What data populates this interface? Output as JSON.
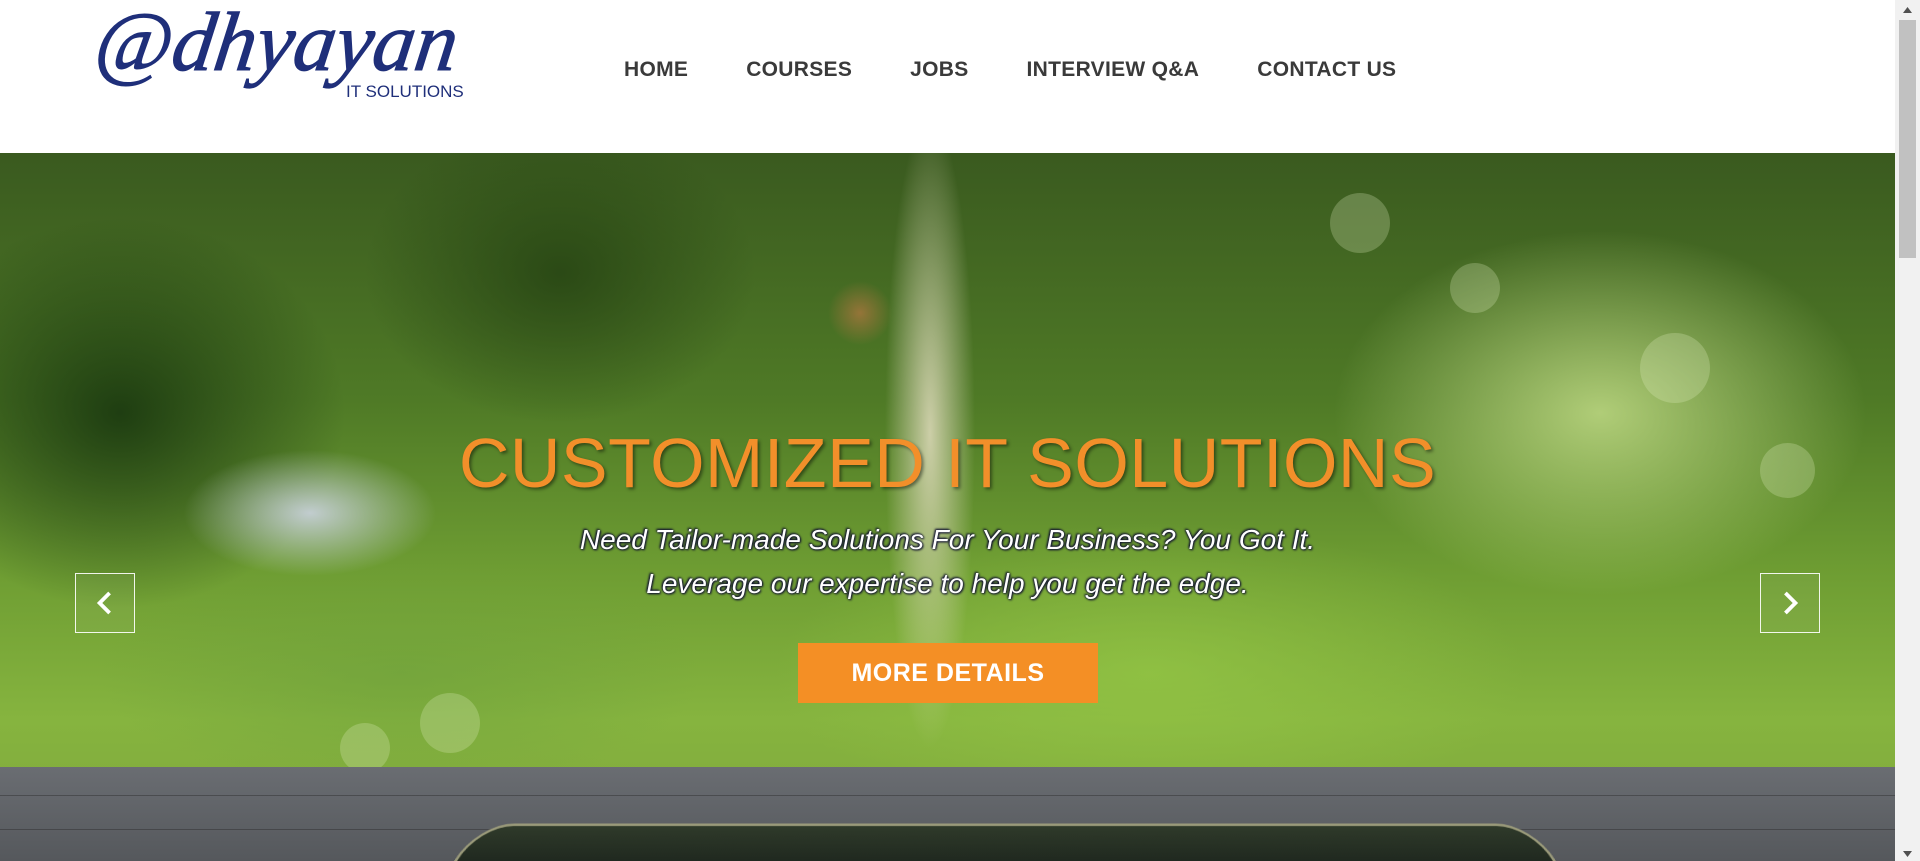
{
  "brand": {
    "logo_text": "@dhyayan",
    "logo_tagline": "IT SOLUTIONS",
    "logo_color": "#1f2f7a"
  },
  "nav": {
    "items": [
      {
        "label": "HOME"
      },
      {
        "label": "COURSES"
      },
      {
        "label": "JOBS"
      },
      {
        "label": "INTERVIEW Q&A"
      },
      {
        "label": "CONTACT US"
      }
    ]
  },
  "hero": {
    "title": "CUSTOMIZED IT SOLUTIONS",
    "subtitle_line1": "Need Tailor-made Solutions For Your Business? You Got It.",
    "subtitle_line2": "Leverage our expertise to help you get the edge.",
    "cta_label": "MORE DETAILS",
    "prev_icon": "chevron-left-icon",
    "next_icon": "chevron-right-icon",
    "title_color": "#f28f2a",
    "cta_color": "#f48f25"
  },
  "scrollbar": {
    "up_icon": "arrow-up-icon",
    "down_icon": "arrow-down-icon"
  }
}
